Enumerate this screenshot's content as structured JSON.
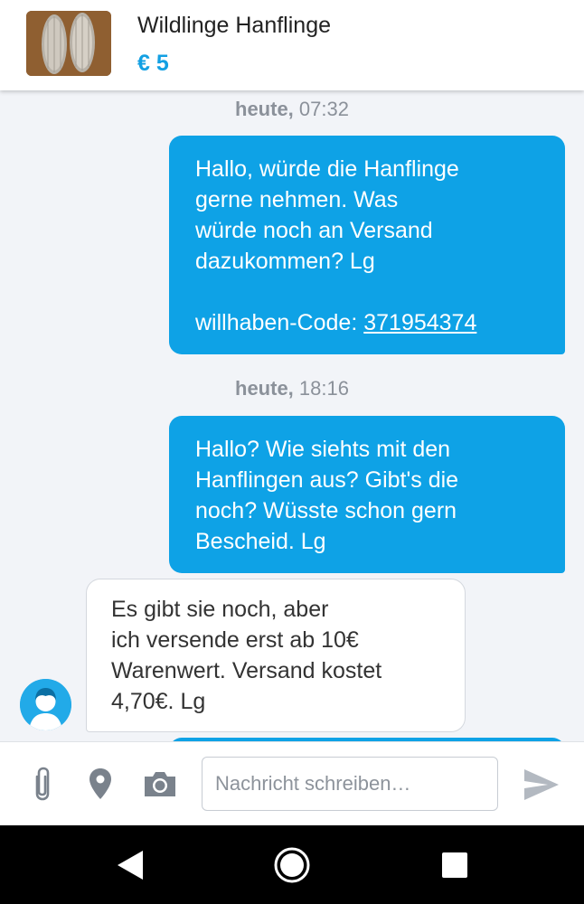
{
  "listing": {
    "title": "Wildlinge Hanflinge",
    "price": "€ 5",
    "thumbnail_icon": "product-photo"
  },
  "messages": [
    {
      "timestamp_day": "heute,",
      "timestamp_time": "07:32",
      "direction": "outgoing",
      "text": "Hallo, würde die Hanflinge\ngerne nehmen. Was\nwürde noch an Versand\ndazukommen? Lg",
      "code_label": "willhaben-Code:",
      "code_value": "371954374"
    },
    {
      "timestamp_day": "heute,",
      "timestamp_time": "18:16",
      "direction": "outgoing",
      "text": "Hallo? Wie siehts mit den\nHanflingen aus? Gibt's die\nnoch? Wüsste schon gern\nBescheid. Lg"
    },
    {
      "direction": "incoming",
      "text": "Es gibt sie noch, aber\nich versende erst ab 10€\nWarenwert. Versand kostet\n4,70€. Lg",
      "avatar_icon": "user-avatar"
    }
  ],
  "composer": {
    "placeholder": "Nachricht schreiben…",
    "icons": [
      "paperclip-icon",
      "location-pin-icon",
      "camera-icon",
      "send-icon"
    ]
  },
  "system_nav": {
    "icons": [
      "back-icon",
      "home-icon",
      "recents-icon"
    ]
  },
  "colors": {
    "accent": "#0ea2e6",
    "price": "#13a0e3",
    "background": "#f2f4f8"
  }
}
